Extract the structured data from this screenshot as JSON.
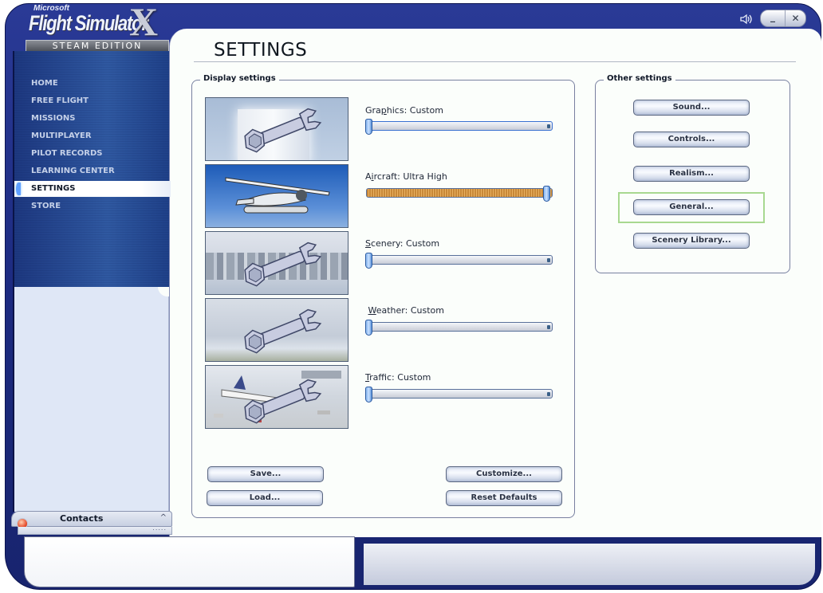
{
  "app": {
    "logo": {
      "brand": "Microsoft",
      "title": "Flight Simulator",
      "title_mark": "X",
      "edition": "STEAM EDITION"
    },
    "window_controls": {
      "speaker_icon": "speaker-icon",
      "minimize_label": "_",
      "close_label": "✕"
    }
  },
  "sidebar": {
    "items": [
      {
        "label": "HOME",
        "active": false
      },
      {
        "label": "FREE FLIGHT",
        "active": false
      },
      {
        "label": "MISSIONS",
        "active": false
      },
      {
        "label": "MULTIPLAYER",
        "active": false
      },
      {
        "label": "PILOT RECORDS",
        "active": false
      },
      {
        "label": "LEARNING CENTER",
        "active": false
      },
      {
        "label": "SETTINGS",
        "active": true
      },
      {
        "label": "STORE",
        "active": false
      }
    ],
    "contacts": {
      "label": "Contacts",
      "caret": "^",
      "grip": "....."
    }
  },
  "page": {
    "title": "SETTINGS"
  },
  "display_settings": {
    "label": "Display settings",
    "sliders": [
      {
        "name": "Graphics",
        "access_key": "p",
        "pre": "Gra",
        "key": "p",
        "post": "hics: Custom",
        "value": 0,
        "thumbnail": "wrench-over-building"
      },
      {
        "name": "Aircraft",
        "pre": "A",
        "key": "i",
        "post": "rcraft: Ultra High",
        "value": 1,
        "thumbnail": "seaplane"
      },
      {
        "name": "Scenery",
        "pre": "",
        "key": "S",
        "post": "cenery: Custom",
        "value": 0,
        "thumbnail": "wrench-over-skyline"
      },
      {
        "name": "Weather",
        "pre": " ",
        "key": "W",
        "post": "eather: Custom",
        "value": 0,
        "thumbnail": "wrench-over-sky"
      },
      {
        "name": "Traffic",
        "pre": "",
        "key": "T",
        "post": "raffic: Custom",
        "value": 0,
        "thumbnail": "wrench-over-airport"
      }
    ],
    "buttons": {
      "save": "Save...",
      "load": "Load...",
      "customize": "Customize...",
      "reset": "Reset Defaults"
    }
  },
  "other_settings": {
    "label": "Other settings",
    "buttons": {
      "sound": "Sound...",
      "controls": "Controls...",
      "realism": "Realism...",
      "general": "General...",
      "scenery_library": "Scenery Library..."
    },
    "highlighted": "general"
  },
  "colors": {
    "frame": "#1f2d86",
    "nav_bg": "#2a4f98",
    "slider_fill": "#d89840",
    "highlight": "#a8d890"
  }
}
